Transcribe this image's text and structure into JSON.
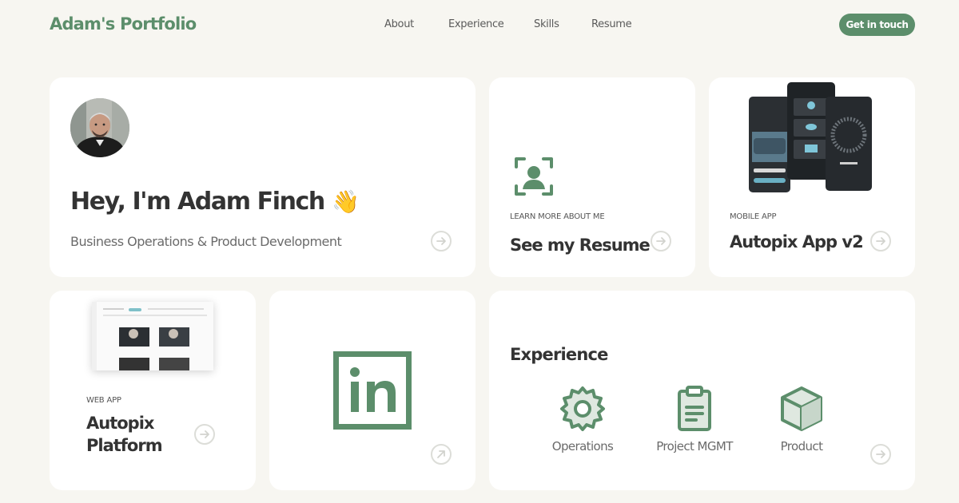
{
  "nav": {
    "logo": "Adam's Portfolio",
    "links": [
      "About",
      "Experience",
      "Skills",
      "Resume"
    ],
    "cta": "Get in touch"
  },
  "hero": {
    "title": "Hey, I'm Adam Finch",
    "emoji": "👋",
    "subtitle": "Business Operations & Product Development"
  },
  "resume_card": {
    "icon": "user-scan-icon",
    "eyebrow": "LEARN MORE ABOUT ME",
    "title": "See my Resume"
  },
  "app_card": {
    "eyebrow": "MOBILE APP",
    "title": "Autopix App v2"
  },
  "web_card": {
    "eyebrow": "WEB APP",
    "title_line1": "Autopix",
    "title_line2": "Platform"
  },
  "linkedin_card": {
    "icon": "linkedin-icon"
  },
  "experience": {
    "title": "Experience",
    "items": [
      {
        "label": "Operations",
        "icon": "gear-icon"
      },
      {
        "label": "Project MGMT",
        "icon": "clipboard-icon"
      },
      {
        "label": "Product",
        "icon": "box-icon"
      }
    ]
  },
  "colors": {
    "accent": "#5c8e6b",
    "background": "#f7f6f1",
    "card": "#ffffff"
  }
}
